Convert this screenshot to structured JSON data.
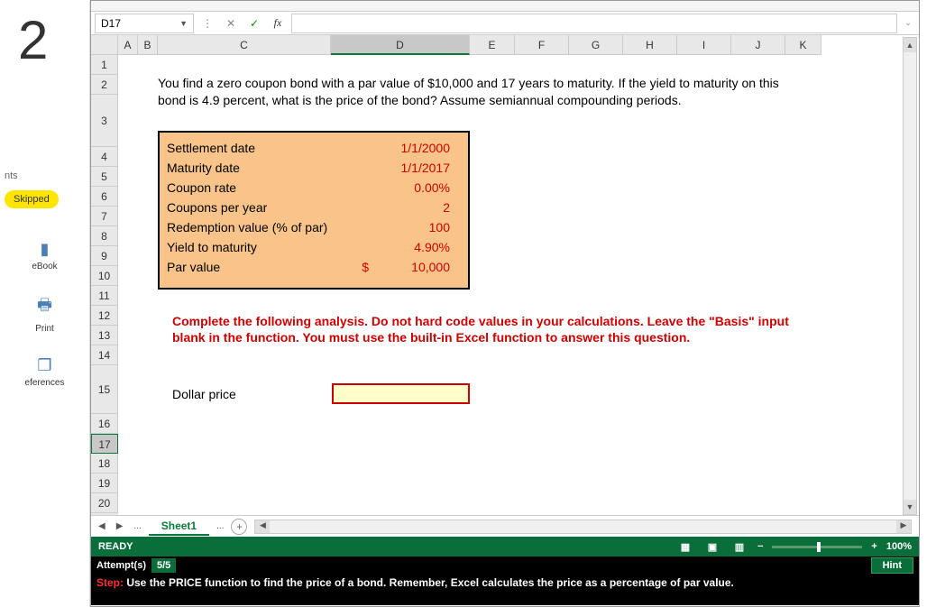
{
  "leftPanel": {
    "number": "2",
    "points": "nts",
    "skipped": "Skipped",
    "tools": {
      "ebook": "eBook",
      "print": "Print",
      "references": "eferences"
    }
  },
  "formulaBar": {
    "nameBox": "D17",
    "formula": ""
  },
  "columns": [
    "A",
    "B",
    "C",
    "D",
    "E",
    "F",
    "G",
    "H",
    "I",
    "J",
    "K"
  ],
  "rows": [
    "1",
    "2",
    "3",
    "4",
    "5",
    "6",
    "7",
    "8",
    "9",
    "10",
    "11",
    "12",
    "13",
    "14",
    "15",
    "16",
    "17",
    "18",
    "19",
    "20"
  ],
  "question": "You find a zero coupon bond with a par value of $10,000 and 17 years to maturity. If the yield to maturity on this bond is 4.9 percent, what is the price of the bond? Assume semiannual compounding periods.",
  "inputs": [
    {
      "label": "Settlement date",
      "cur": "",
      "value": "1/1/2000"
    },
    {
      "label": "Maturity date",
      "cur": "",
      "value": "1/1/2017"
    },
    {
      "label": "Coupon rate",
      "cur": "",
      "value": "0.00%"
    },
    {
      "label": "Coupons per year",
      "cur": "",
      "value": "2"
    },
    {
      "label": "Redemption value (% of par)",
      "cur": "",
      "value": "100"
    },
    {
      "label": "Yield to maturity",
      "cur": "",
      "value": "4.90%"
    },
    {
      "label": "Par value",
      "cur": "$",
      "value": "10,000"
    }
  ],
  "instruction": "Complete the following analysis. Do not hard code values in your calculations.  Leave the \"Basis\" input blank in the function. You must use the built-in Excel function to answer this question.",
  "answerLabel": "Dollar price",
  "tabs": {
    "sheet1": "Sheet1",
    "dots": "..."
  },
  "statusBar": {
    "ready": "READY",
    "zoom": "100%"
  },
  "attemptBar": {
    "label": "Attempt(s)",
    "count": "5/5",
    "hint": "Hint"
  },
  "stepBar": {
    "prefix": "Step:",
    "text": "Use the PRICE function to find the price of a bond. Remember, Excel calculates the price as a percentage of par value."
  }
}
